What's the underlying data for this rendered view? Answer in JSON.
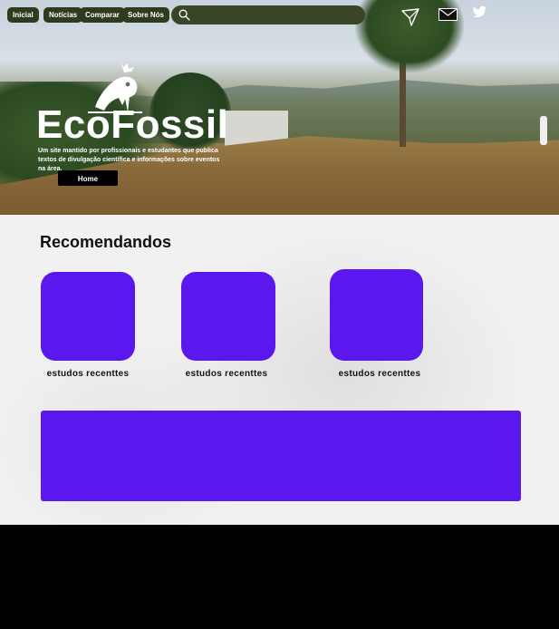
{
  "nav": {
    "items": [
      {
        "label": "Inicial"
      },
      {
        "label": "Notícias"
      },
      {
        "label": "Comparar"
      },
      {
        "label": "Sobre Nós"
      }
    ],
    "search_placeholder": ""
  },
  "icons": {
    "search": "search-icon",
    "send": "paper-plane-icon",
    "mail": "envelope-icon",
    "twitter": "twitter-bird-icon"
  },
  "brand": {
    "title": "EcoFossil",
    "tagline": "Um site mantido por profissionais e estudantes que publica textos de divulgação científica e informações sobre eventos na área.",
    "home_label": "Home"
  },
  "recommended": {
    "title": "Recomendandos",
    "cards": [
      {
        "label": "estudos recenttes"
      },
      {
        "label": "estudos recenttes"
      },
      {
        "label": "estudos recenttes"
      }
    ]
  },
  "colors": {
    "accent": "#5a18ee",
    "nav_button": "#2f3a1f",
    "footer": "#000000",
    "content_bg": "#f1f1f2"
  }
}
